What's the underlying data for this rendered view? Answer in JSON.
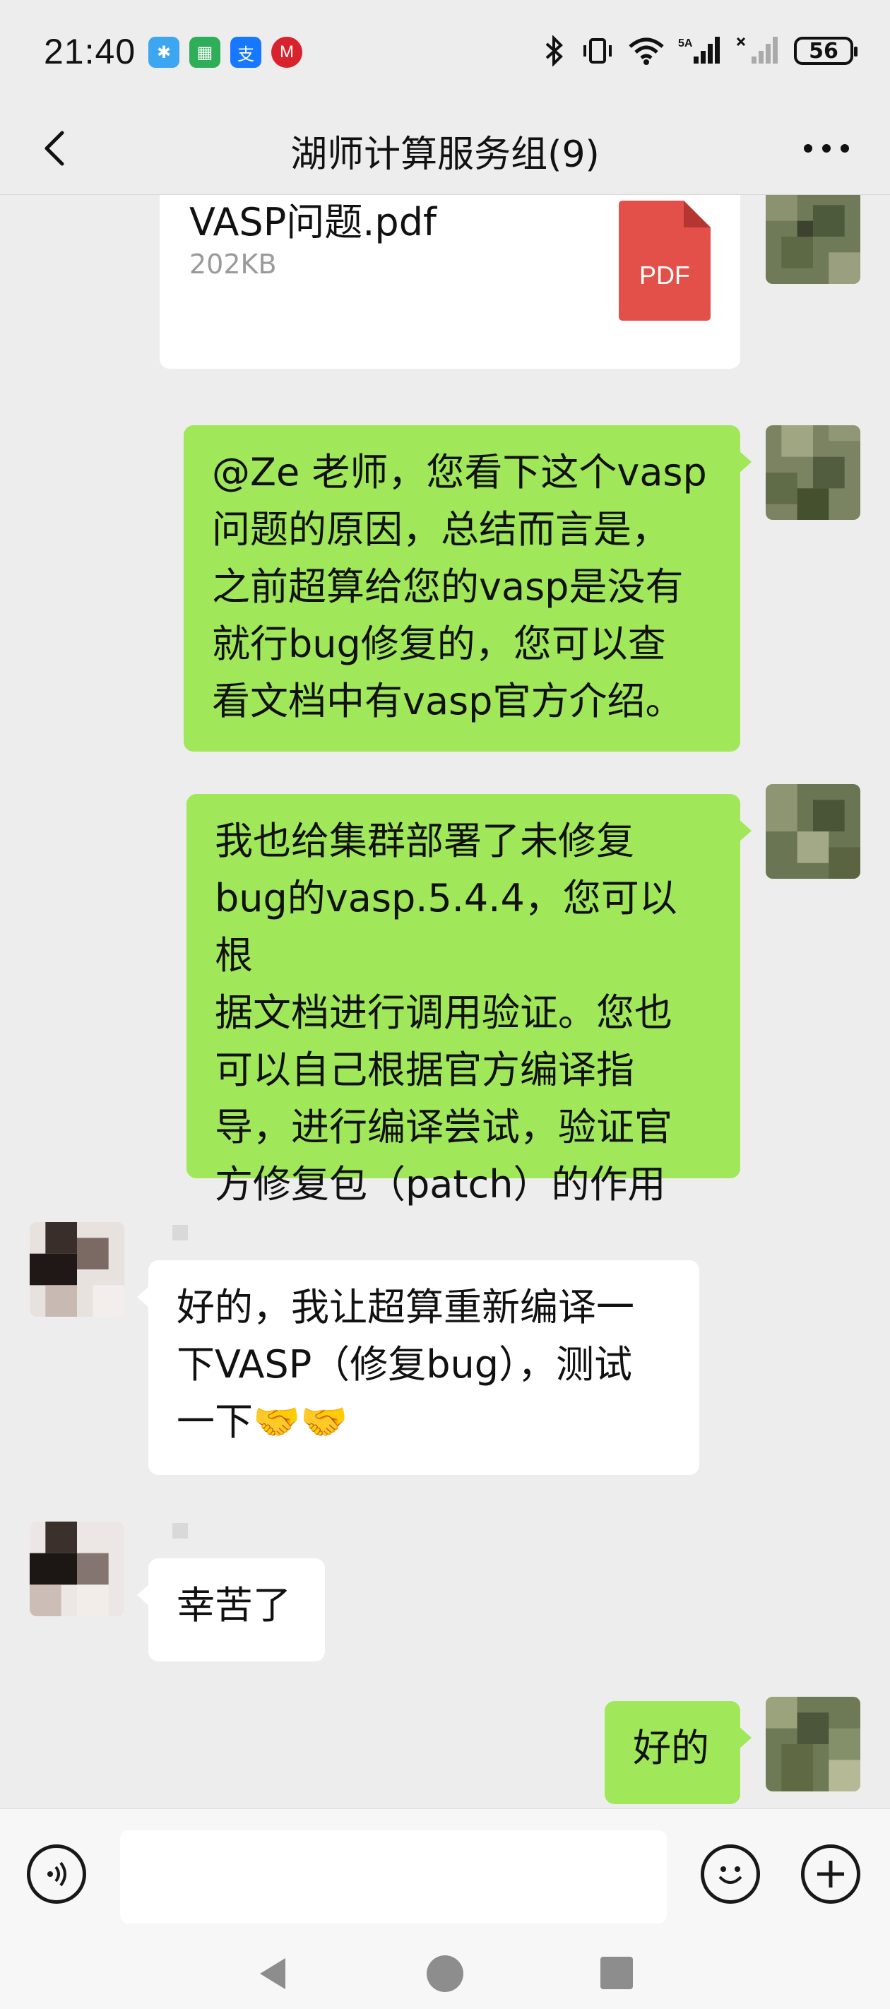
{
  "status_bar": {
    "time": "21:40",
    "app_icons": [
      "tplink-icon",
      "green-app-icon",
      "alipay-icon",
      "cmb-bank-icon"
    ],
    "network_label": "5A",
    "battery": "56"
  },
  "header": {
    "title": "湖师计算服务组(9)"
  },
  "messages": {
    "file": {
      "name": "VASP问题.pdf",
      "size": "202KB",
      "badge": "PDF"
    },
    "m1": {
      "lines": [
        "@Ze 老师，您看下这个vasp",
        "问题的原因，总结而言是，",
        "之前超算给您的vasp是没有",
        "就行bug修复的，您可以查",
        "看文档中有vasp官方介绍。"
      ]
    },
    "m2": {
      "lines": [
        "我也给集群部署了未修复",
        "bug的vasp.5.4.4，您可以根",
        "据文档进行调用验证。您也",
        "可以自己根据官方编译指",
        "导，进行编译尝试，验证官",
        "方修复包（patch）的作用"
      ]
    },
    "m3": {
      "lines": [
        "好的，我让超算重新编译一",
        "下VASP（修复bug），测试",
        "一下🤝🤝"
      ]
    },
    "m4": {
      "text": "幸苦了"
    },
    "m5": {
      "text": "好的"
    }
  },
  "colors": {
    "background": "#ededed",
    "self_bubble": "#a0e75a",
    "other_bubble": "#ffffff",
    "pdf_red": "#e3504a"
  }
}
